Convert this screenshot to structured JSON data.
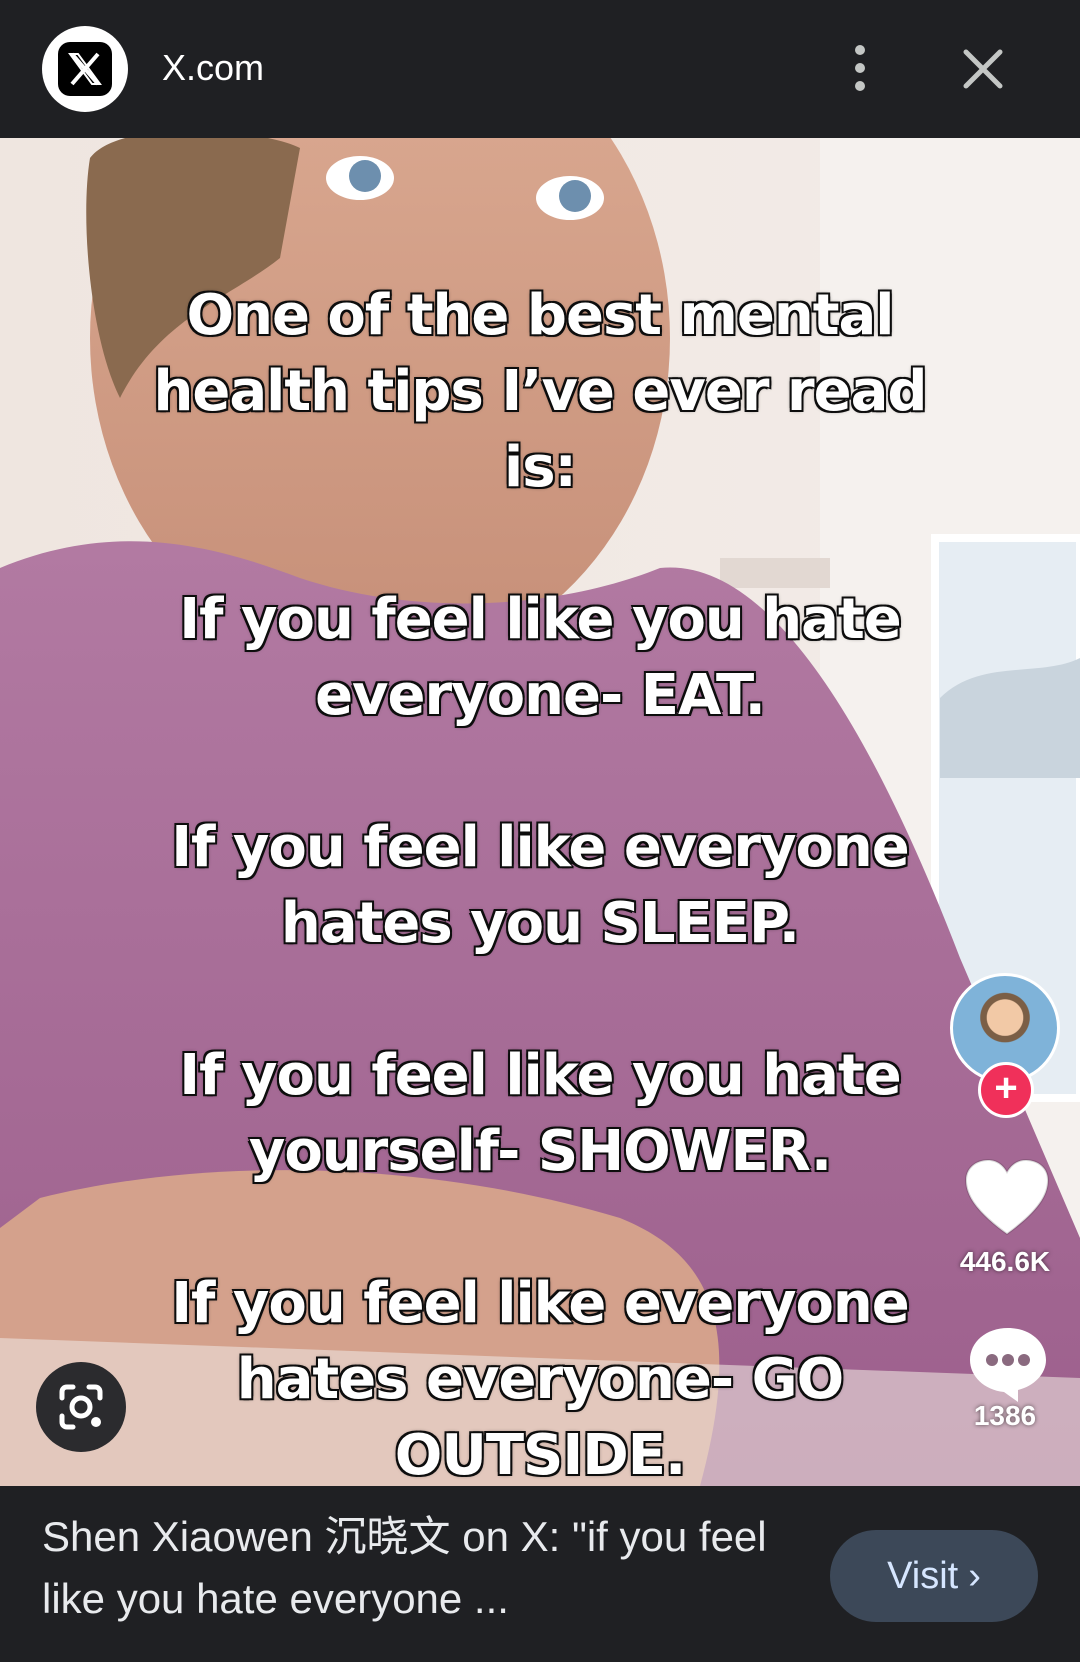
{
  "topbar": {
    "site_name": "X.com",
    "logo_icon": "x-logo-icon",
    "menu_icon": "more-vert-icon",
    "close_icon": "close-icon"
  },
  "media": {
    "caption_paragraphs": [
      "One of the best mental\nhealth tips I’ve ever read\nis:",
      "If you feel like you hate\neveryone- EAT.",
      "If you feel like everyone\nhates you SLEEP.",
      "If you feel like you hate\nyourself- SHOWER.",
      "If you feel like everyone\nhates everyone- GO\nOUTSIDE."
    ],
    "follow_symbol": "+",
    "like_count": "446.6K",
    "comment_count": "1386",
    "colors": {
      "follow_button": "#f0305a",
      "shirt": "#b27aa2"
    }
  },
  "result": {
    "title": "Shen Xiaowen 沉晓文 on X: \"if you feel like you hate everyone ...",
    "visit_label": "Visit",
    "visit_chevron": "›"
  }
}
